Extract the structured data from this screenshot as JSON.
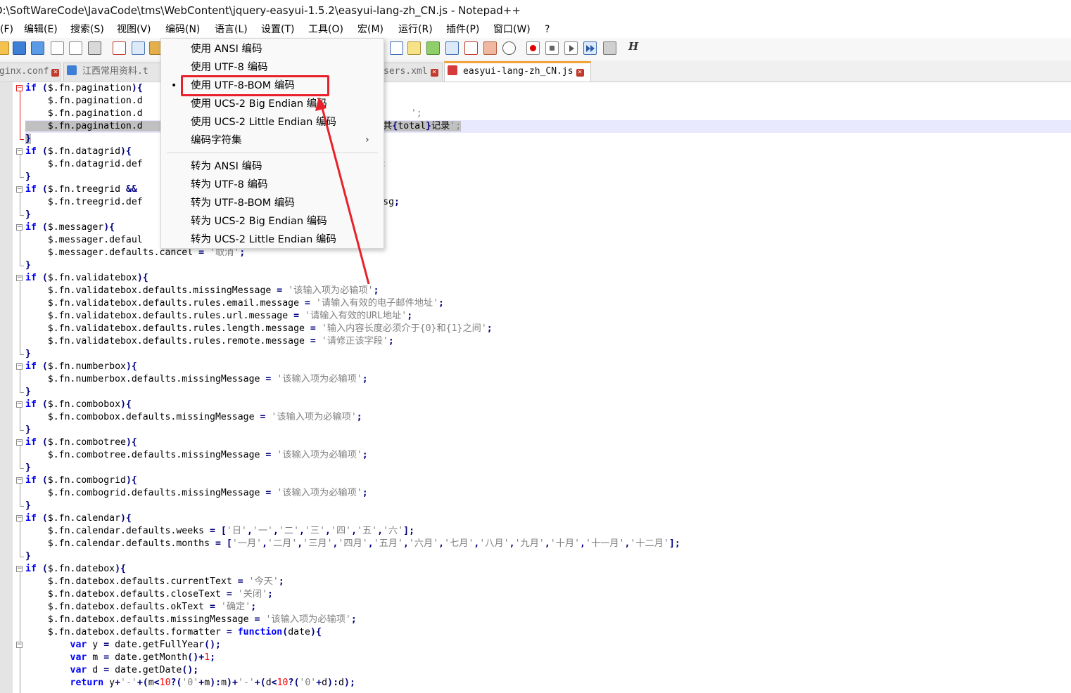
{
  "window": {
    "title": "D:\\SoftWareCode\\JavaCode\\tms\\WebContent\\jquery-easyui-1.5.2\\easyui-lang-zh_CN.js - Notepad++"
  },
  "menubar": {
    "items": [
      "(F)",
      "编辑(E)",
      "搜索(S)",
      "视图(V)",
      "编码(N)",
      "语言(L)",
      "设置(T)",
      "工具(O)",
      "宏(M)",
      "运行(R)",
      "插件(P)",
      "窗口(W)",
      "?"
    ]
  },
  "toolbar": {
    "macro_label": "H"
  },
  "tabs": [
    {
      "label": "ginx.conf"
    },
    {
      "label": "江西常用资料.t"
    },
    {
      "label": "sers.xml"
    },
    {
      "label": "easyui-lang-zh_CN.js",
      "active": true
    }
  ],
  "encoding_menu": {
    "use_items": [
      "使用 ANSI 编码",
      "使用 UTF-8 编码",
      "使用 UTF-8-BOM 编码",
      "使用 UCS-2 Big Endian 编码",
      "使用 UCS-2 Little Endian 编码",
      "编码字符集"
    ],
    "selected_bullet": "•",
    "convert_items": [
      "转为 ANSI 编码",
      "转为 UTF-8 编码",
      "转为 UTF-8-BOM 编码",
      "转为 UCS-2 Big Endian 编码",
      "转为 UCS-2 Little Endian 编码"
    ],
    "submenu_chevron": "›"
  },
  "code_lines": [
    "if ($.fn.pagination){",
    "    $.fn.pagination.d",
    "    $.fn.pagination.d                                                ';",
    "    $.fn.pagination.d                                        o},共{total}记录';",
    "}",
    "if ($.fn.datagrid){",
    "    $.fn.datagrid.def                                        。';",
    "}",
    "if ($.fn.treegrid &&",
    "    $.fn.treegrid.def                                   ts.loadMsg;",
    "}",
    "if ($.messager){",
    "    $.messager.defaul",
    "    $.messager.defaults.cancel = '取消';",
    "}",
    "if ($.fn.validatebox){",
    "    $.fn.validatebox.defaults.missingMessage = '该输入项为必输项';",
    "    $.fn.validatebox.defaults.rules.email.message = '请输入有效的电子邮件地址';",
    "    $.fn.validatebox.defaults.rules.url.message = '请输入有效的URL地址';",
    "    $.fn.validatebox.defaults.rules.length.message = '输入内容长度必须介于{0}和{1}之间';",
    "    $.fn.validatebox.defaults.rules.remote.message = '请修正该字段';",
    "}",
    "if ($.fn.numberbox){",
    "    $.fn.numberbox.defaults.missingMessage = '该输入项为必输项';",
    "}",
    "if ($.fn.combobox){",
    "    $.fn.combobox.defaults.missingMessage = '该输入项为必输项';",
    "}",
    "if ($.fn.combotree){",
    "    $.fn.combotree.defaults.missingMessage = '该输入项为必输项';",
    "}",
    "if ($.fn.combogrid){",
    "    $.fn.combogrid.defaults.missingMessage = '该输入项为必输项';",
    "}",
    "if ($.fn.calendar){",
    "    $.fn.calendar.defaults.weeks = ['日','一','二','三','四','五','六'];",
    "    $.fn.calendar.defaults.months = ['一月','二月','三月','四月','五月','六月','七月','八月','九月','十月','十一月','十二月'];",
    "}",
    "if ($.fn.datebox){",
    "    $.fn.datebox.defaults.currentText = '今天';",
    "    $.fn.datebox.defaults.closeText = '关闭';",
    "    $.fn.datebox.defaults.okText = '确定';",
    "    $.fn.datebox.defaults.missingMessage = '该输入项为必输项';",
    "    $.fn.datebox.defaults.formatter = function(date){",
    "        var y = date.getFullYear();",
    "        var m = date.getMonth()+1;",
    "        var d = date.getDate();",
    "        return y+'-'+(m<10?('0'+m):m)+'-'+(d<10?('0'+d):d);"
  ],
  "colors": {
    "keyword": "#0000ff",
    "operator": "#000080",
    "string": "#808080",
    "number": "#ff0000",
    "annotation": "#e8202a",
    "active_tab_accent": "#f2a33a"
  }
}
